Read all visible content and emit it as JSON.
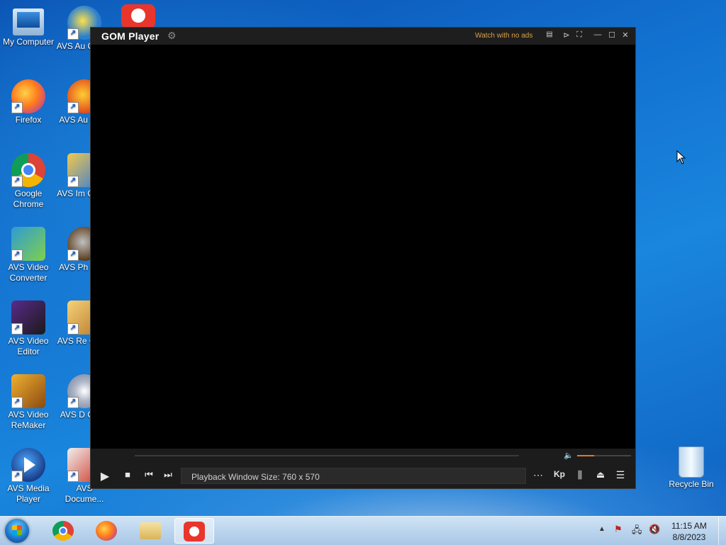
{
  "desktop": {
    "icons_left": [
      {
        "label": "My Computer",
        "name": "my-computer-icon"
      },
      {
        "label": "Firefox",
        "name": "firefox-icon"
      },
      {
        "label": "Google Chrome",
        "name": "chrome-icon"
      },
      {
        "label": "AVS Video Converter",
        "name": "avs-video-converter-icon"
      },
      {
        "label": "AVS Video Editor",
        "name": "avs-video-editor-icon"
      },
      {
        "label": "AVS Video ReMaker",
        "name": "avs-video-remaker-icon"
      },
      {
        "label": "AVS Media Player",
        "name": "avs-media-player-icon"
      }
    ],
    "icons_middle": [
      {
        "label": "AVS Au Conve",
        "name": "avs-audio-converter-icon"
      },
      {
        "label": "AVS Au Edito",
        "name": "avs-audio-editor-icon"
      },
      {
        "label": "AVS Im Conve",
        "name": "avs-image-converter-icon"
      },
      {
        "label": "AVS Ph Edito",
        "name": "avs-photo-editor-icon"
      },
      {
        "label": "AVS Re Clean",
        "name": "avs-registry-cleaner-icon"
      },
      {
        "label": "AVS D Great",
        "name": "avs-disc-creator-icon"
      },
      {
        "label": "AVS Docume...",
        "name": "avs-document-converter-icon"
      }
    ],
    "recycle_bin": {
      "label": "Recycle Bin"
    }
  },
  "gom": {
    "logo": "GOM Player",
    "watch_no_ads": "Watch with no ads",
    "status": "Playback Window Size: 760 x 570",
    "volume_fraction": 0.32,
    "seek_fraction": 0.0
  },
  "taskbar": {
    "time": "11:15 AM",
    "date": "8/8/2023"
  },
  "colors": {
    "accent": "#e07b2a",
    "watch_no_ads": "#d9a24b"
  }
}
